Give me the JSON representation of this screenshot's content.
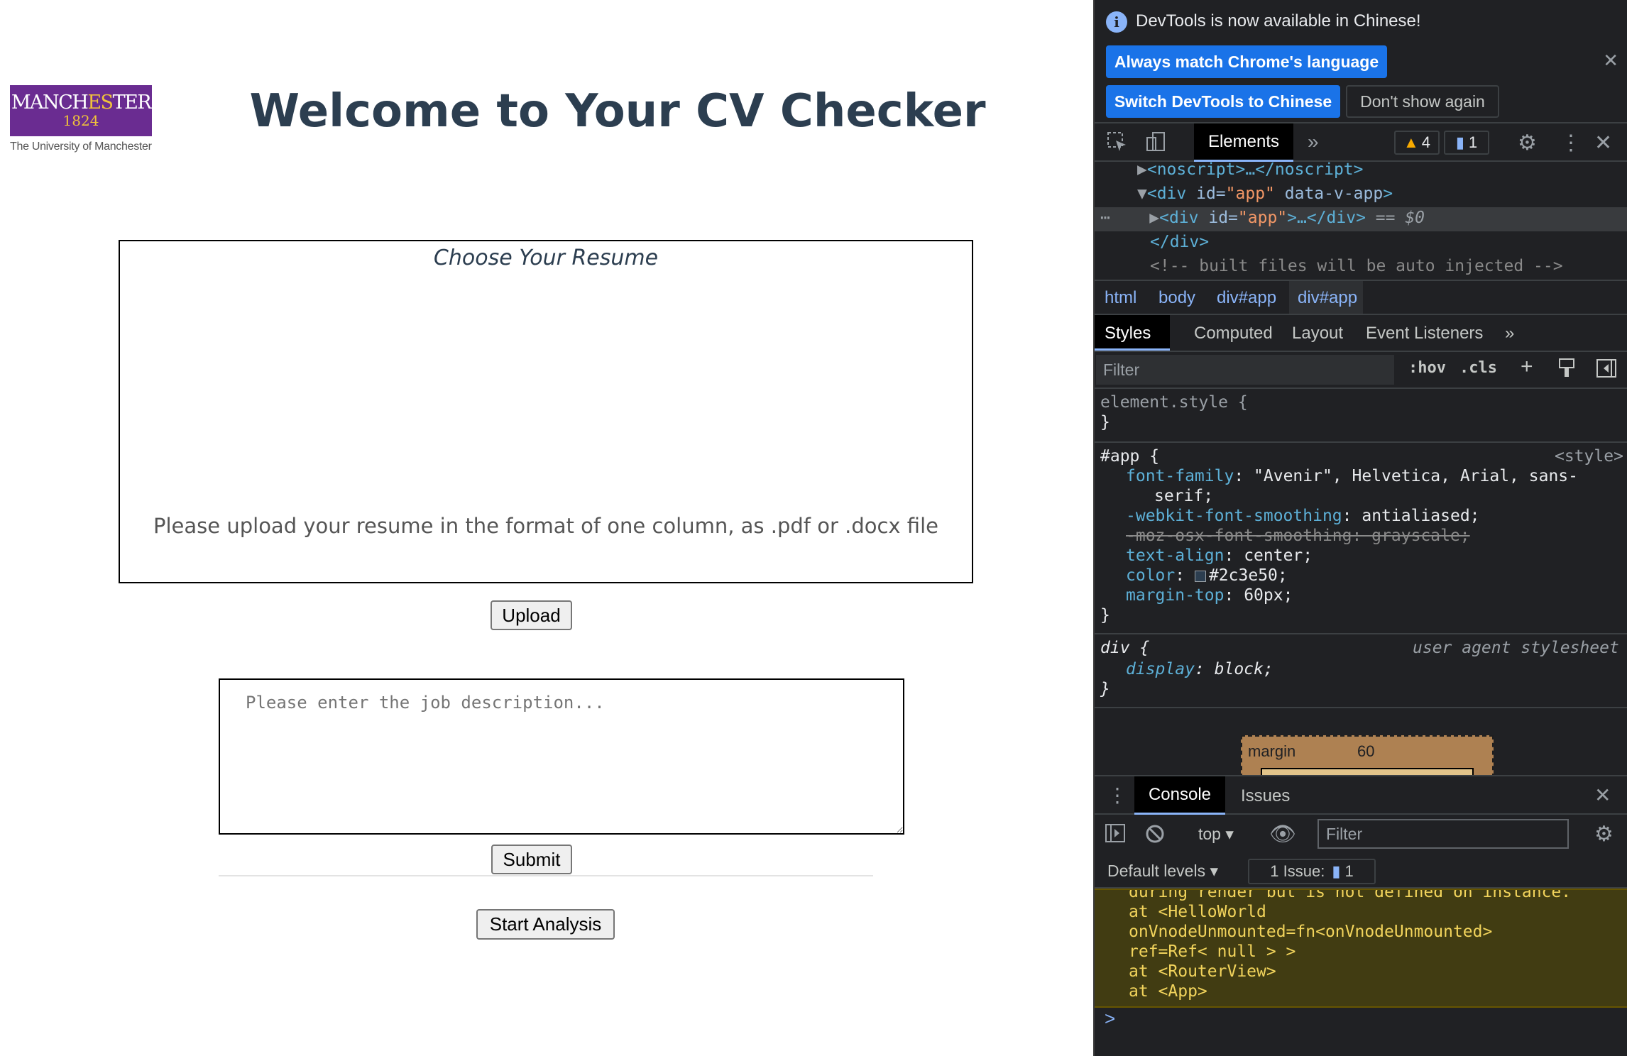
{
  "page": {
    "logo": {
      "name_part1": "MANCH",
      "name_part2": "ES",
      "name_part3": "TER",
      "year": "1824",
      "subtitle": "The University of Manchester"
    },
    "title": "Welcome to Your CV Checker",
    "upload": {
      "title": "Choose Your Resume",
      "hint": "Please upload your resume in the format of one column, as .pdf or .docx file",
      "button_label": "Upload"
    },
    "job_description": {
      "placeholder": "Please enter the job description...",
      "value": ""
    },
    "submit_label": "Submit",
    "start_analysis_label": "Start Analysis",
    "text_color": "#2c3e50"
  },
  "devtools": {
    "notice": {
      "text": "DevTools is now available in Chinese!",
      "btn_match": "Always match Chrome's language",
      "btn_switch": "Switch DevTools to Chinese",
      "btn_dont_show": "Don't show again"
    },
    "tabs": {
      "elements": "Elements",
      "warnings_count": "4",
      "messages_count": "1"
    },
    "dom": {
      "line1": "<noscript>…</noscript>",
      "line2_tag": "<div ",
      "line2_attr1": "id=",
      "line2_val1": "\"app\"",
      "line2_attr2": " data-v-app",
      "line2_end": ">",
      "line3_tag": "<div ",
      "line3_attr": "id=",
      "line3_val": "\"app\"",
      "line3_end": ">…</div>",
      "line3_suffix": " == $0",
      "line4": "</div>",
      "line5": "<!-- built files will be auto injected -->"
    },
    "breadcrumbs": [
      "html",
      "body",
      "div#app",
      "div#app"
    ],
    "subtabs": [
      "Styles",
      "Computed",
      "Layout",
      "Event Listeners"
    ],
    "filter_placeholder": "Filter",
    "hov": ":hov",
    "cls": ".cls",
    "styles": {
      "element_style": "element.style {",
      "close": "}",
      "app_selector": "#app {",
      "app_source": "<style>",
      "p1_name": "font-family",
      "p1_value": "\"Avenir\", Helvetica, Arial, sans-",
      "p1_cont": "serif;",
      "p2_name": "-webkit-font-smoothing",
      "p2_value": "antialiased;",
      "p3": "-moz-osx-font-smoothing: grayscale;",
      "p4_name": "text-align",
      "p4_value": "center;",
      "p5_name": "color",
      "p5_value": "#2c3e50;",
      "p6_name": "margin-top",
      "p6_value": "60px;",
      "div_selector": "div {",
      "div_source": "user agent stylesheet",
      "div_prop": "display",
      "div_value": "block;"
    },
    "boxmodel": {
      "label": "margin",
      "value": "60"
    },
    "drawer": {
      "console": "Console",
      "issues": "Issues",
      "context": "top",
      "filter_placeholder": "Filter",
      "levels": "Default levels",
      "issues_badge": "1 Issue:",
      "issues_count": "1"
    },
    "console_lines": [
      "during render but is not defined on instance.",
      "  at <HelloWorld",
      "onVnodeUnmounted=fn<onVnodeUnmounted>",
      "ref=Ref< null > >",
      "  at <RouterView>",
      "  at <App>"
    ],
    "prompt": ">"
  }
}
